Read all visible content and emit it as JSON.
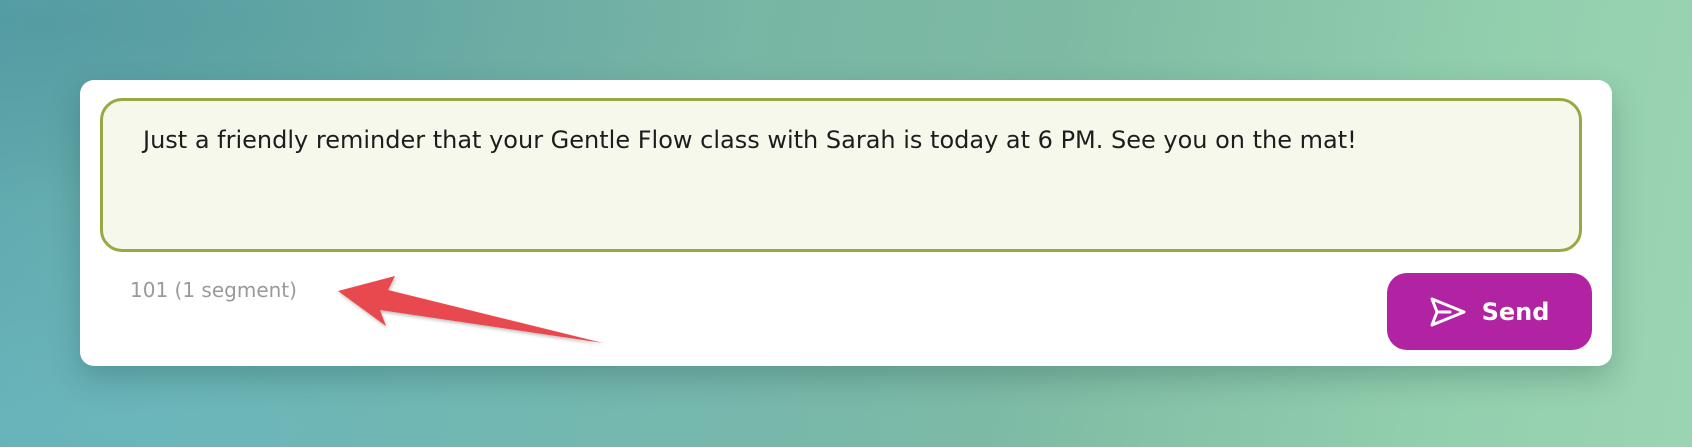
{
  "composer": {
    "message_text": "Just a friendly reminder that your Gentle Flow class with Sarah is today at 6 PM. See you on the mat!",
    "char_count": "101 (1 segment)",
    "send_label": "Send",
    "send_icon": "paper-plane-icon"
  },
  "colors": {
    "border_accent": "#96aa44",
    "field_background": "#f6f8ec",
    "send_button": "#b123a2",
    "annotation_arrow": "#e84a4f"
  }
}
